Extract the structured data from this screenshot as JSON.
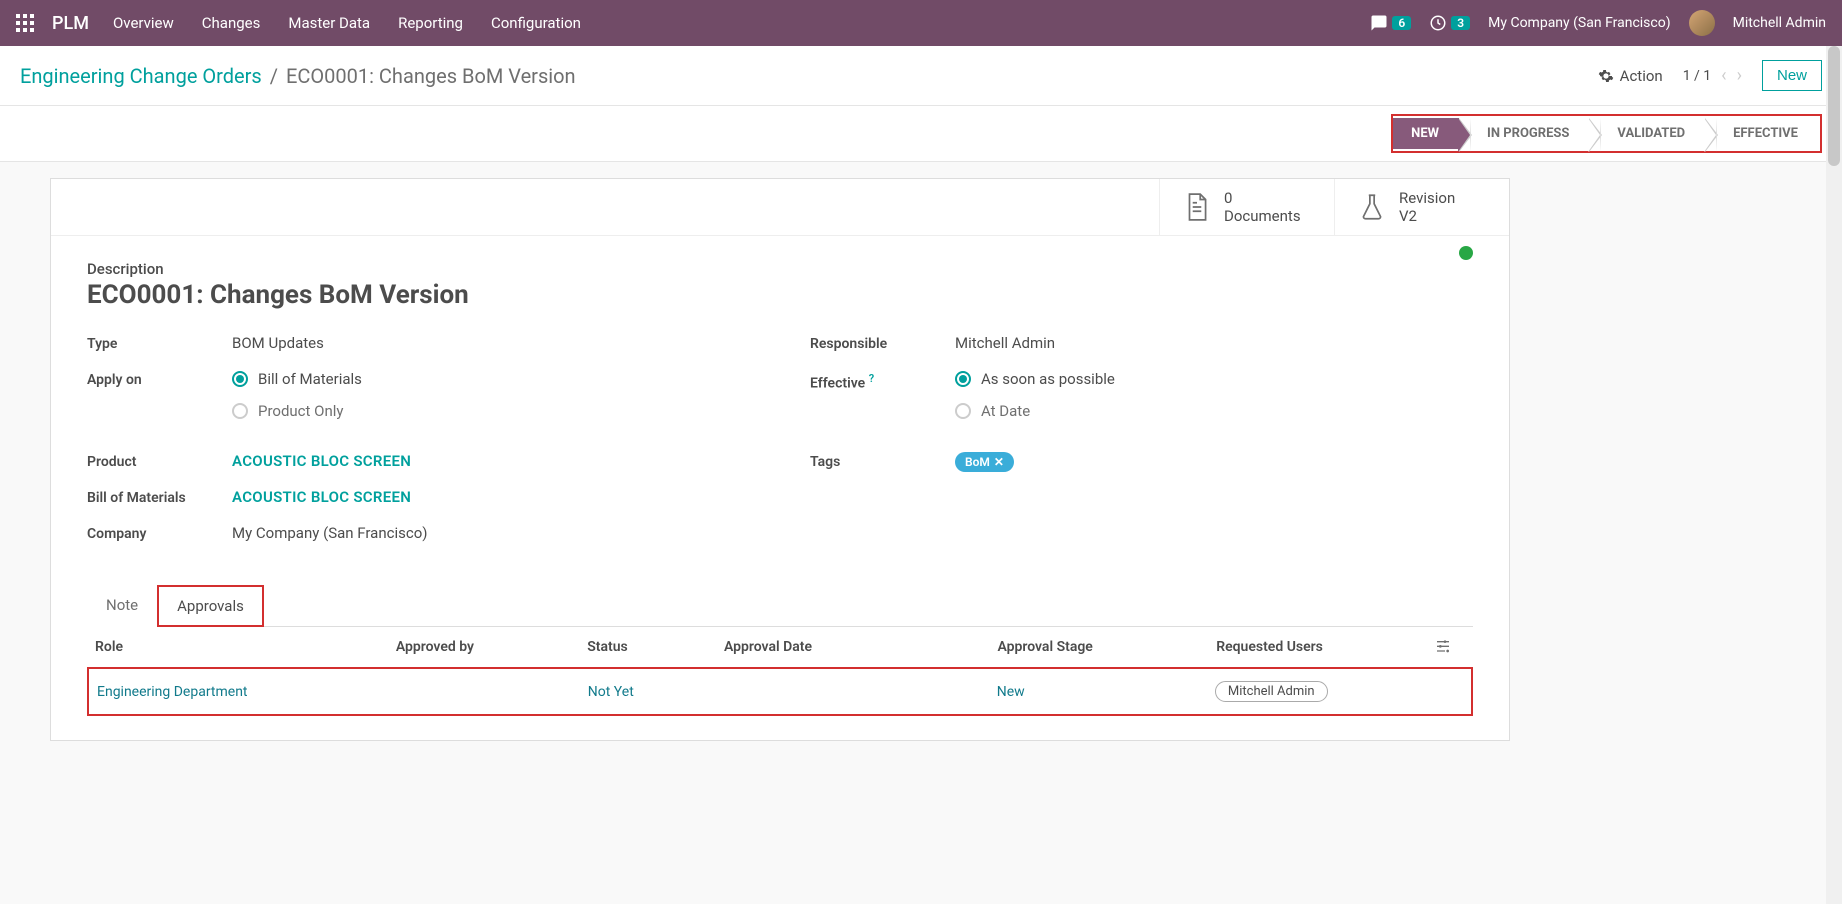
{
  "navbar": {
    "brand": "PLM",
    "links": [
      "Overview",
      "Changes",
      "Master Data",
      "Reporting",
      "Configuration"
    ],
    "messages_badge": "6",
    "activities_badge": "3",
    "company": "My Company (San Francisco)",
    "user": "Mitchell Admin"
  },
  "breadcrumb": {
    "root": "Engineering Change Orders",
    "current": "ECO0001: Changes BoM Version"
  },
  "controls": {
    "action_label": "Action",
    "pager": "1 / 1",
    "new_label": "New"
  },
  "stages": [
    "NEW",
    "IN PROGRESS",
    "VALIDATED",
    "EFFECTIVE"
  ],
  "stat_buttons": {
    "documents_count": "0",
    "documents_label": "Documents",
    "revision_label": "Revision",
    "revision_value": "V2"
  },
  "form": {
    "description_label": "Description",
    "title": "ECO0001: Changes  BoM Version",
    "left": {
      "type_label": "Type",
      "type_value": "BOM Updates",
      "apply_on_label": "Apply on",
      "apply_on_opts": {
        "bom": "Bill of Materials",
        "product": "Product Only"
      },
      "product_label": "Product",
      "product_value": "ACOUSTIC BLOC SCREEN",
      "bom_label": "Bill of Materials",
      "bom_value": "ACOUSTIC BLOC SCREEN",
      "company_label": "Company",
      "company_value": "My Company (San Francisco)"
    },
    "right": {
      "responsible_label": "Responsible",
      "responsible_value": "Mitchell Admin",
      "effective_label": "Effective",
      "effective_opts": {
        "asap": "As soon as possible",
        "atdate": "At Date"
      },
      "tags_label": "Tags",
      "tag_text": "BoM"
    }
  },
  "tabs": {
    "note": "Note",
    "approvals": "Approvals"
  },
  "table": {
    "headers": {
      "role": "Role",
      "approved_by": "Approved by",
      "status": "Status",
      "approval_date": "Approval Date",
      "approval_stage": "Approval Stage",
      "requested_users": "Requested Users"
    },
    "row": {
      "role": "Engineering Department",
      "approved_by": "",
      "status": "Not Yet",
      "approval_date": "",
      "approval_stage": "New",
      "requested_user": "Mitchell Admin"
    }
  }
}
